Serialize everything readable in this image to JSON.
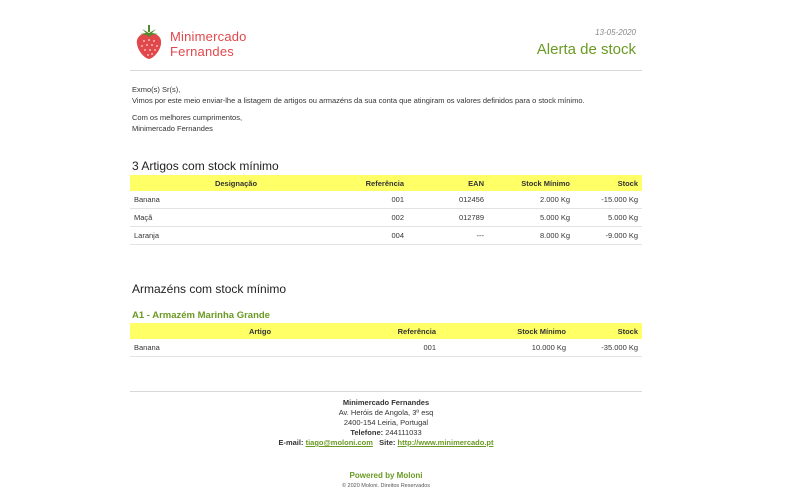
{
  "header": {
    "brand_line1": "Minimercado",
    "brand_line2": "Fernandes",
    "date": "13-05-2020",
    "title": "Alerta de stock"
  },
  "intro": {
    "greeting": "Exmo(s) Sr(s),",
    "body": "Vimos por este meio enviar-lhe a listagem de artigos ou armazéns da sua conta que atingiram os valores definidos para o stock mínimo.",
    "closing": "Com os melhores cumprimentos,",
    "signature": "Minimercado Fernandes"
  },
  "articles": {
    "title": "3 Artigos com stock mínimo",
    "columns": [
      "Designação",
      "Referência",
      "EAN",
      "Stock Mínimo",
      "Stock"
    ],
    "rows": [
      [
        "Banana",
        "001",
        "012456",
        "2.000 Kg",
        "-15.000 Kg"
      ],
      [
        "Maçã",
        "002",
        "012789",
        "5.000 Kg",
        "5.000 Kg"
      ],
      [
        "Laranja",
        "004",
        "---",
        "8.000 Kg",
        "-9.000 Kg"
      ]
    ]
  },
  "warehouses": {
    "title": "Armazéns com stock mínimo",
    "warehouse_name": "A1 - Armazém Marinha Grande",
    "columns": [
      "Artigo",
      "Referência",
      "Stock Mínimo",
      "Stock"
    ],
    "rows": [
      [
        "Banana",
        "001",
        "10.000 Kg",
        "-35.000 Kg"
      ]
    ]
  },
  "footer": {
    "company": "Minimercado Fernandes",
    "address1": "Av. Heróis de Angola, 3º esq",
    "address2": "2400-154 Leiria, Portugal",
    "phone_label": "Telefone:",
    "phone": "244111033",
    "email_label": "E-mail:",
    "email": "tiago@moloni.com",
    "site_label": "Site:",
    "site": "http://www.minimercado.pt",
    "powered": "Powered by Moloni",
    "copyright": "© 2020 Moloni. Direitos Reservados"
  },
  "colors": {
    "brand": "#e0484c",
    "accent_green": "#6a9a23",
    "table_header": "#ffff66"
  },
  "icons": {
    "logo": "strawberry-icon"
  }
}
